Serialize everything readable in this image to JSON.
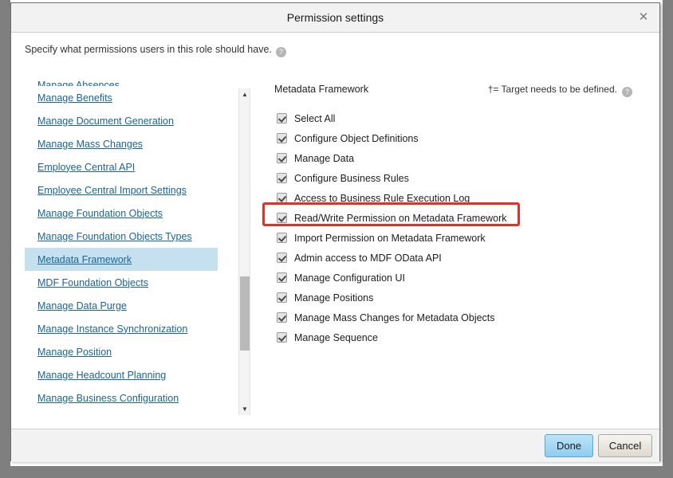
{
  "dialog": {
    "title": "Permission settings",
    "close_label": "✕",
    "instruction": "Specify what permissions users in this role should have.",
    "help_icon_label": "?"
  },
  "sidebar": {
    "items": [
      {
        "label": "Manage Absences",
        "selected": false,
        "clipped": true
      },
      {
        "label": "Manage Benefits",
        "selected": false,
        "clipped": false
      },
      {
        "label": "Manage Document Generation",
        "selected": false,
        "clipped": false
      },
      {
        "label": "Manage Mass Changes",
        "selected": false,
        "clipped": false
      },
      {
        "label": "Employee Central API",
        "selected": false,
        "clipped": false
      },
      {
        "label": "Employee Central Import Settings",
        "selected": false,
        "clipped": false
      },
      {
        "label": "Manage Foundation Objects",
        "selected": false,
        "clipped": false
      },
      {
        "label": "Manage Foundation Objects Types",
        "selected": false,
        "clipped": false
      },
      {
        "label": "Metadata Framework",
        "selected": true,
        "clipped": false
      },
      {
        "label": "MDF Foundation Objects",
        "selected": false,
        "clipped": false
      },
      {
        "label": "Manage Data Purge",
        "selected": false,
        "clipped": false
      },
      {
        "label": "Manage Instance Synchronization",
        "selected": false,
        "clipped": false
      },
      {
        "label": "Manage Position",
        "selected": false,
        "clipped": false
      },
      {
        "label": "Manage Headcount Planning",
        "selected": false,
        "clipped": false
      },
      {
        "label": "Manage Business Configuration",
        "selected": false,
        "clipped": false
      }
    ],
    "scroll_up_label": "▲",
    "scroll_down_label": "▼"
  },
  "permissions": {
    "category_title": "Metadata Framework",
    "target_note": "†= Target needs to be defined.",
    "help_icon_label": "?",
    "items": [
      {
        "label": "Select All",
        "checked": true
      },
      {
        "label": "Configure Object Definitions",
        "checked": true
      },
      {
        "label": "Manage Data",
        "checked": true
      },
      {
        "label": "Configure Business Rules",
        "checked": true
      },
      {
        "label": "Access to Business Rule Execution Log",
        "checked": true
      },
      {
        "label": "Read/Write Permission on Metadata Framework",
        "checked": true,
        "highlighted": true
      },
      {
        "label": "Import Permission on Metadata Framework",
        "checked": true
      },
      {
        "label": "Admin access to MDF OData API",
        "checked": true
      },
      {
        "label": "Manage Configuration UI",
        "checked": true
      },
      {
        "label": "Manage Positions",
        "checked": true
      },
      {
        "label": "Manage Mass Changes for Metadata Objects",
        "checked": true
      },
      {
        "label": "Manage Sequence",
        "checked": true
      }
    ]
  },
  "footer": {
    "done_label": "Done",
    "cancel_label": "Cancel"
  },
  "colors": {
    "accent_highlight": "#ee2b23",
    "selected_row": "#c5e1ef",
    "link": "#1a6496",
    "primary_button": "#8ecdf0"
  }
}
